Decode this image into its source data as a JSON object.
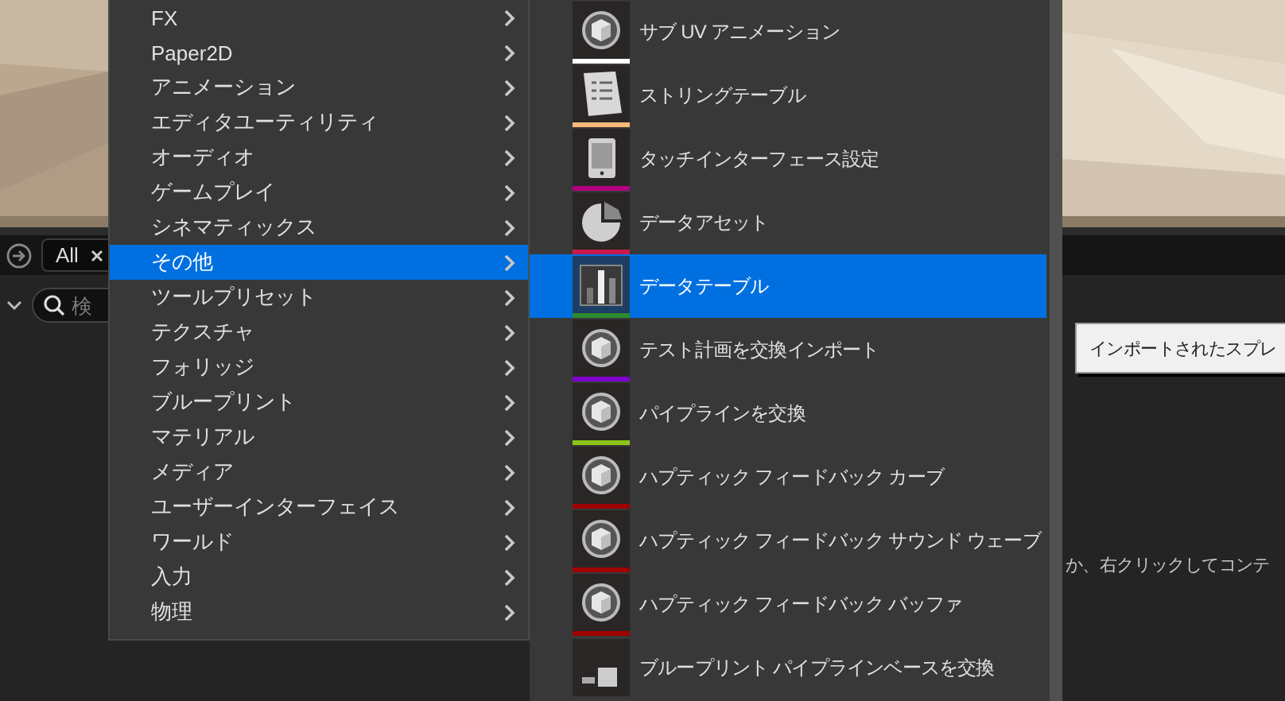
{
  "toolbar": {
    "filter_chip": "All",
    "search_placeholder": "検"
  },
  "category_menu": [
    {
      "label": "FX",
      "selected": false
    },
    {
      "label": "Paper2D",
      "selected": false
    },
    {
      "label": "アニメーション",
      "selected": false
    },
    {
      "label": "エディタユーティリティ",
      "selected": false
    },
    {
      "label": "オーディオ",
      "selected": false
    },
    {
      "label": "ゲームプレイ",
      "selected": false
    },
    {
      "label": "シネマティックス",
      "selected": false
    },
    {
      "label": "その他",
      "selected": true
    },
    {
      "label": "ツールプリセット",
      "selected": false
    },
    {
      "label": "テクスチャ",
      "selected": false
    },
    {
      "label": "フォリッジ",
      "selected": false
    },
    {
      "label": "ブループリント",
      "selected": false
    },
    {
      "label": "マテリアル",
      "selected": false
    },
    {
      "label": "メディア",
      "selected": false
    },
    {
      "label": "ユーザーインターフェイス",
      "selected": false
    },
    {
      "label": "ワールド",
      "selected": false
    },
    {
      "label": "入力",
      "selected": false
    },
    {
      "label": "物理",
      "selected": false
    }
  ],
  "submenu": [
    {
      "label": "サブ UV アニメーション",
      "kind": "cube",
      "color": "#ffffff",
      "selected": false
    },
    {
      "label": "ストリングテーブル",
      "kind": "document",
      "color": "#f7b87a",
      "selected": false
    },
    {
      "label": "タッチインターフェース設定",
      "kind": "tablet",
      "color": "#b0007e",
      "selected": false
    },
    {
      "label": "データアセット",
      "kind": "pie",
      "color": "#c81a4a",
      "selected": false
    },
    {
      "label": "データテーブル",
      "kind": "chart",
      "color": "#2e8b2e",
      "selected": true
    },
    {
      "label": "テスト計画を交換インポート",
      "kind": "cube",
      "color": "#8000d0",
      "selected": false
    },
    {
      "label": "パイプラインを交換",
      "kind": "cube",
      "color": "#8cc41a",
      "selected": false
    },
    {
      "label": "ハプティック フィードバック カーブ",
      "kind": "cube",
      "color": "#a00000",
      "selected": false
    },
    {
      "label": "ハプティック フィードバック サウンド ウェーブ",
      "kind": "cube",
      "color": "#a00000",
      "selected": false
    },
    {
      "label": "ハプティック フィードバック バッファ",
      "kind": "cube",
      "color": "#a00000",
      "selected": false
    },
    {
      "label": "ブループリント パイプラインベースを交換",
      "kind": "pipeline",
      "selected": false
    }
  ],
  "import_button": "インポートされたスプレ",
  "hint_text": "か、右クリックしてコンテ"
}
